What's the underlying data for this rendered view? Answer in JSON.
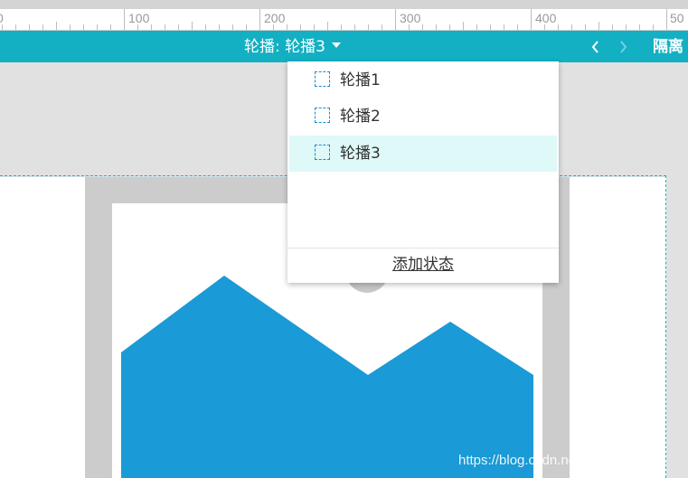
{
  "ruler": {
    "labels": [
      "0",
      "100",
      "200",
      "300",
      "400",
      "50"
    ]
  },
  "state_bar": {
    "title": "轮播: 轮播3",
    "prev_icon": "chevron-left-icon",
    "next_icon": "chevron-right-icon",
    "isolate_label": "隔离"
  },
  "dropdown": {
    "items": [
      {
        "label": "轮播1",
        "selected": false
      },
      {
        "label": "轮播2",
        "selected": false
      },
      {
        "label": "轮播3",
        "selected": true
      }
    ],
    "add_state_label": "添加状态"
  },
  "watermark": "https://blog.csdn.net/qq_47081253",
  "colors": {
    "accent": "#12b0c2",
    "selected_bg": "#dff8f8",
    "image_fill": "#1a9ad6",
    "frame": "#cccccc"
  }
}
